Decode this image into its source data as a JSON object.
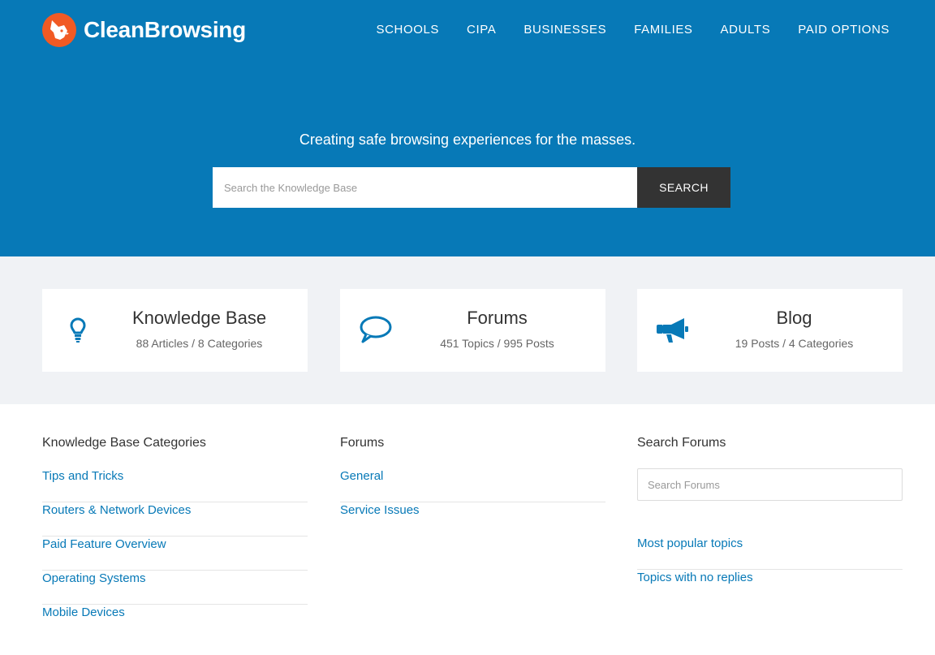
{
  "brand": {
    "name": "CleanBrowsing",
    "accent": "#0779b7",
    "logo_color": "#f15a24",
    "icon": "fox-logo-icon"
  },
  "nav": {
    "items": [
      {
        "label": "SCHOOLS"
      },
      {
        "label": "CIPA"
      },
      {
        "label": "BUSINESSES"
      },
      {
        "label": "FAMILIES"
      },
      {
        "label": "ADULTS"
      },
      {
        "label": "PAID OPTIONS"
      }
    ]
  },
  "hero": {
    "tagline": "Creating safe browsing experiences for the masses.",
    "search_placeholder": "Search the Knowledge Base",
    "search_button": "SEARCH"
  },
  "cards": [
    {
      "title": "Knowledge Base",
      "meta": "88 Articles / 8 Categories",
      "icon": "lightbulb-icon"
    },
    {
      "title": "Forums",
      "meta": "451 Topics / 995 Posts",
      "icon": "speech-bubble-icon"
    },
    {
      "title": "Blog",
      "meta": "19 Posts / 4 Categories",
      "icon": "megaphone-icon"
    }
  ],
  "kb_categories": {
    "title": "Knowledge Base Categories",
    "items": [
      {
        "label": "Tips and Tricks"
      },
      {
        "label": "Routers & Network Devices"
      },
      {
        "label": "Paid Feature Overview"
      },
      {
        "label": "Operating Systems"
      },
      {
        "label": "Mobile Devices"
      }
    ]
  },
  "forums": {
    "title": "Forums",
    "items": [
      {
        "label": "General"
      },
      {
        "label": "Service Issues"
      }
    ]
  },
  "search_forums": {
    "title": "Search Forums",
    "placeholder": "Search Forums",
    "links": [
      {
        "label": "Most popular topics"
      },
      {
        "label": "Topics with no replies"
      }
    ]
  }
}
